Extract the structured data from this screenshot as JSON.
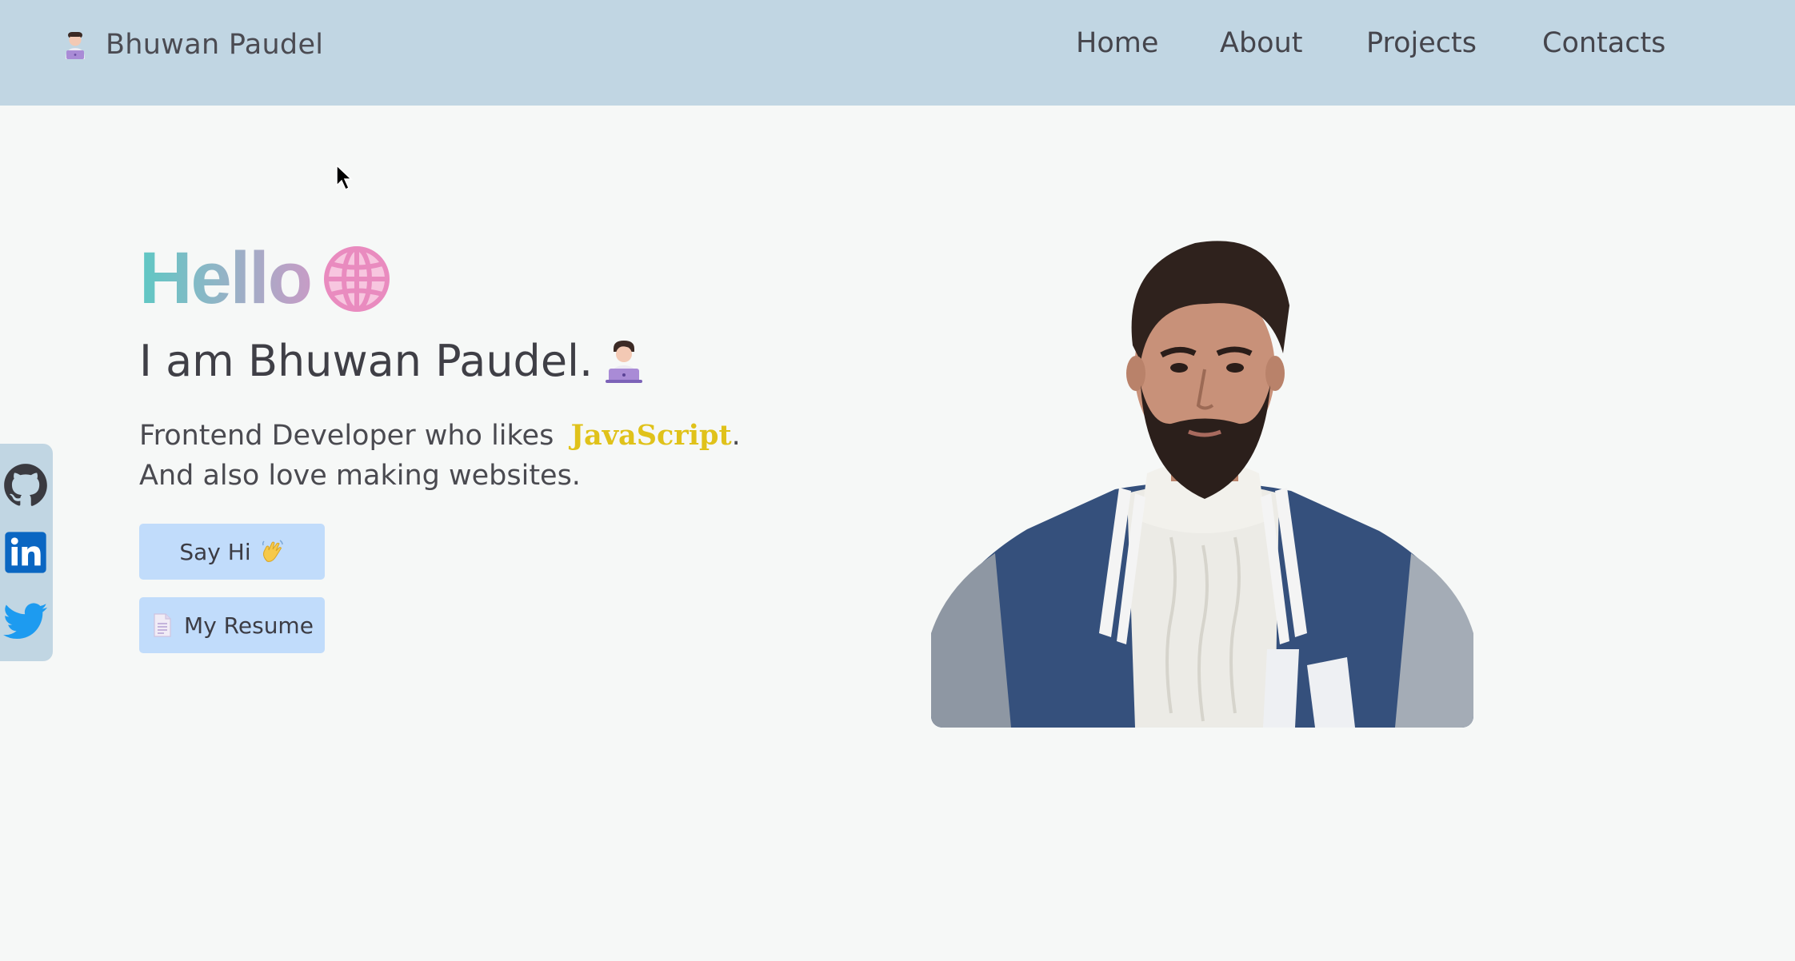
{
  "header": {
    "brand_name": "Bhuwan Paudel",
    "brand_icon": "technologist-emoji",
    "nav": {
      "home": "Home",
      "about": "About",
      "projects": "Projects",
      "contacts": "Contacts"
    }
  },
  "hero": {
    "greeting": "Hello",
    "greeting_icon": "globe-icon",
    "intro": "I am Bhuwan Paudel.",
    "intro_icon": "technologist-emoji",
    "tagline_before": "Frontend Developer who likes",
    "tagline_highlight": "JavaScript",
    "tagline_after": ". And also love making websites.",
    "say_hi_label": "Say Hi",
    "say_hi_icon": "waving-hand-emoji",
    "resume_label": "My Resume",
    "resume_icon": "document-icon"
  },
  "social": [
    "github-icon",
    "linkedin-icon",
    "twitter-icon"
  ],
  "colors": {
    "header_bg": "#c1d6e3",
    "page_bg": "#f6f8f7",
    "button_bg": "#c1dcfb",
    "javascript_highlight": "#e0c21a",
    "hello_gradient": [
      "#5ec8c4",
      "#c79cc6"
    ],
    "globe": "#e98bbf"
  }
}
